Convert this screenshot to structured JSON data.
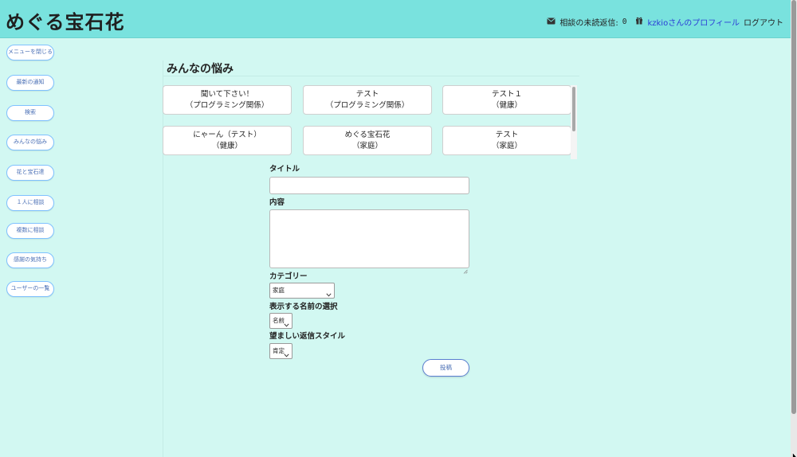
{
  "header": {
    "logo": "めぐる宝石花",
    "unread_label": "相談の未読返信:",
    "unread_count": "0",
    "profile_link": "kzkioさんのプロフィール",
    "logout": "ログアウト",
    "icons": [
      "envelope-icon",
      "gift-icon"
    ]
  },
  "sidebar": {
    "items": [
      {
        "label": "メニューを閉じる"
      },
      {
        "label": "最新の通知"
      },
      {
        "label": "検索"
      },
      {
        "label": "みんなの悩み"
      },
      {
        "label": "花と宝石達"
      },
      {
        "label": "１人に相談"
      },
      {
        "label": "複数に相談"
      },
      {
        "label": "感謝の気持ち"
      },
      {
        "label": "ユーザーの一覧"
      }
    ]
  },
  "main": {
    "title": "みんなの悩み",
    "cards": [
      {
        "title": "聞いて下さい！",
        "category": "（プログラミング関係）"
      },
      {
        "title": "テスト",
        "category": "（プログラミング関係）"
      },
      {
        "title": "テスト１",
        "category": "（健康）"
      },
      {
        "title": "にゃーん（テスト）",
        "category": "（健康）"
      },
      {
        "title": "めぐる宝石花",
        "category": "（家庭）"
      },
      {
        "title": "テスト",
        "category": "（家庭）"
      }
    ]
  },
  "form": {
    "title_label": "タイトル",
    "title_value": "",
    "content_label": "内容",
    "content_value": "",
    "category_label": "カテゴリー",
    "category_selected": "家庭",
    "name_label": "表示する名前の選択",
    "name_selected": "名前",
    "style_label": "望ましい返信スタイル",
    "style_selected": "肯定",
    "submit": "投稿"
  },
  "colors": {
    "background": "#d2f8f2",
    "header": "#79e2de",
    "link": "#2a3bd6",
    "button_border": "#7fc1ff"
  }
}
